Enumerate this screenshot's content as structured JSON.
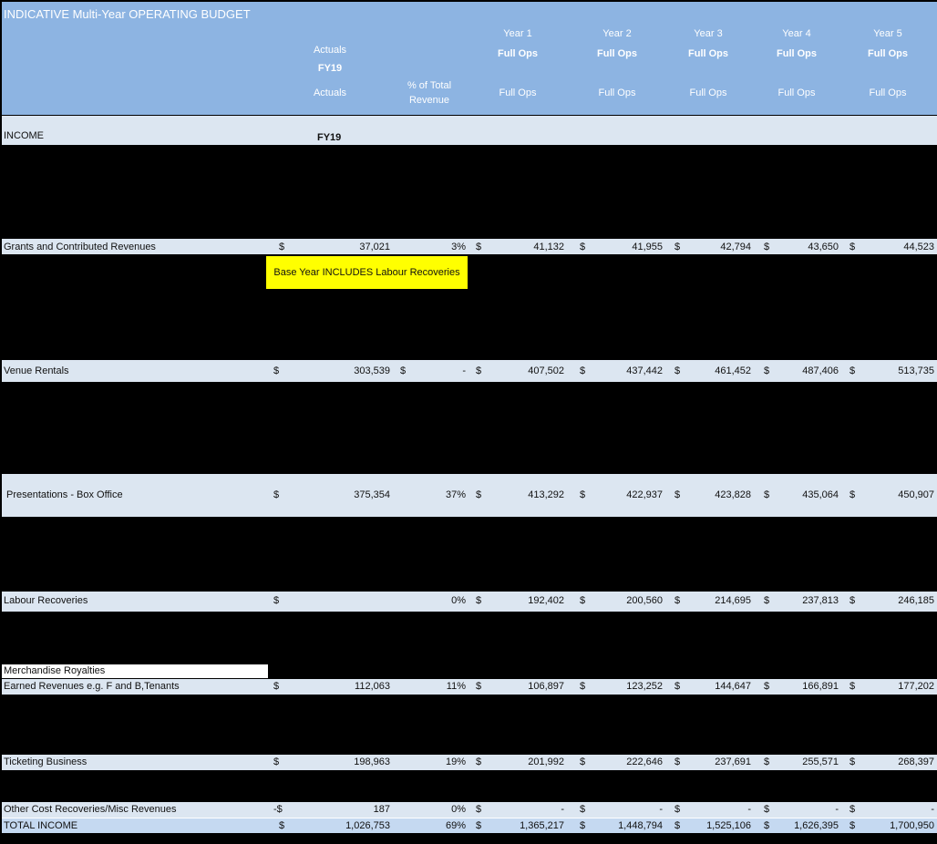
{
  "title": "INDICATIVE Multi-Year OPERATING BUDGET",
  "header": {
    "actuals_top": "Actuals",
    "fy19_top": "FY19",
    "actuals_bottom": "Actuals",
    "pct_line1": "% of Total",
    "pct_line2": "Revenue",
    "years": [
      {
        "label": "Year 1",
        "sub": "Full Ops",
        "sub2": "Full Ops"
      },
      {
        "label": "Year 2",
        "sub": "Full Ops",
        "sub2": "Full Ops"
      },
      {
        "label": "Year 3",
        "sub": "Full Ops",
        "sub2": "Full Ops"
      },
      {
        "label": "Year 4",
        "sub": "Full Ops",
        "sub2": "Full Ops"
      },
      {
        "label": "Year 5",
        "sub": "Full Ops",
        "sub2": "Full Ops"
      }
    ]
  },
  "income_label": "INCOME",
  "income_fy": "FY19",
  "note": "Base Year INCLUDES Labour Recoveries",
  "merch_label": "Merchandise Royalties",
  "rows": [
    {
      "label": "Grants and Contributed Revenues",
      "cur": "$",
      "actual": "37,021",
      "pct_cur": "",
      "pct": "3%",
      "s": [
        "$",
        "$",
        "$",
        "$",
        "$"
      ],
      "v": [
        "41,132",
        "41,955",
        "42,794",
        "43,650",
        "44,523"
      ]
    },
    {
      "label": "Venue Rentals",
      "cur": "$",
      "actual": "303,539",
      "pct_cur": "$",
      "pct": "-",
      "s": [
        "$",
        "$",
        "$",
        "$",
        "$"
      ],
      "v": [
        "407,502",
        "437,442",
        "461,452",
        "487,406",
        "513,735"
      ]
    },
    {
      "label": "Presentations - Box Office",
      "cur": "$",
      "actual": "375,354",
      "pct_cur": "",
      "pct": "37%",
      "s": [
        "$",
        "$",
        "$",
        "$",
        "$"
      ],
      "v": [
        "413,292",
        "422,937",
        "423,828",
        "435,064",
        "450,907"
      ]
    },
    {
      "label": "Labour Recoveries",
      "cur": "$",
      "actual": "",
      "pct_cur": "",
      "pct": "0%",
      "s": [
        "$",
        "$",
        "$",
        "$",
        "$"
      ],
      "v": [
        "192,402",
        "200,560",
        "214,695",
        "237,813",
        "246,185"
      ]
    },
    {
      "label": "Earned Revenues e.g. F and B,Tenants",
      "cur": "$",
      "actual": "112,063",
      "pct_cur": "",
      "pct": "11%",
      "s": [
        "$",
        "$",
        "$",
        "$",
        "$"
      ],
      "v": [
        "106,897",
        "123,252",
        "144,647",
        "166,891",
        "177,202"
      ]
    },
    {
      "label": "Ticketing Business",
      "cur": "$",
      "actual": "198,963",
      "pct_cur": "",
      "pct": "19%",
      "s": [
        "$",
        "$",
        "$",
        "$",
        "$"
      ],
      "v": [
        "201,992",
        "222,646",
        "237,691",
        "255,571",
        "268,397"
      ]
    },
    {
      "label": "Other Cost Recoveries/Misc Revenues",
      "cur": "-$",
      "actual": "187",
      "pct_cur": "",
      "pct": "0%",
      "s": [
        "$",
        "$",
        "$",
        "$",
        "$"
      ],
      "v": [
        "-",
        "-",
        "-",
        "-",
        "-"
      ]
    },
    {
      "label": "TOTAL INCOME",
      "cur": "$",
      "actual": "1,026,753",
      "pct_cur": "",
      "pct": "69%",
      "s": [
        "$",
        "$",
        "$",
        "$",
        "$"
      ],
      "v": [
        "1,365,217",
        "1,448,794",
        "1,525,106",
        "1,626,395",
        "1,700,950"
      ]
    }
  ]
}
